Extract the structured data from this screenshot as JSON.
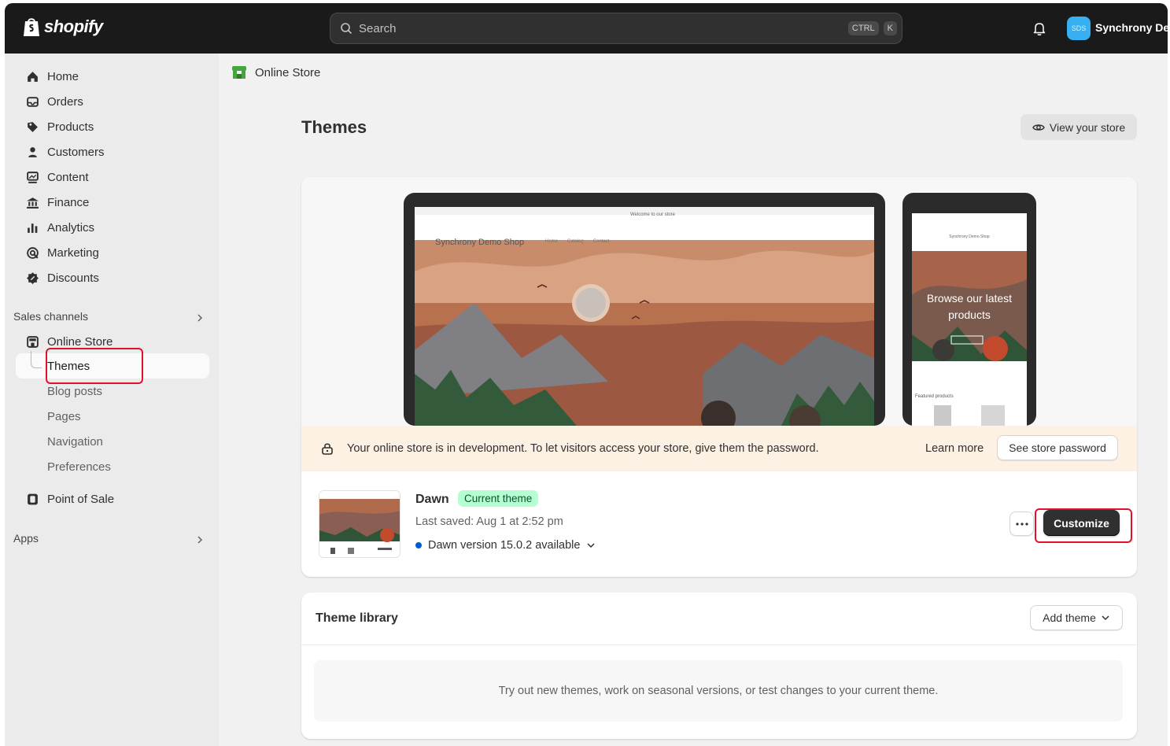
{
  "app": {
    "logo_text": "shopify"
  },
  "topbar": {
    "search_placeholder": "Search",
    "shortcut_ctrl": "CTRL",
    "shortcut_key": "K",
    "avatar_initials": "SDS",
    "store_name": "Synchrony De"
  },
  "sidebar": {
    "items": [
      {
        "label": "Home",
        "icon": "home-icon"
      },
      {
        "label": "Orders",
        "icon": "inbox-icon"
      },
      {
        "label": "Products",
        "icon": "tag-icon"
      },
      {
        "label": "Customers",
        "icon": "person-icon"
      },
      {
        "label": "Content",
        "icon": "image-icon"
      },
      {
        "label": "Finance",
        "icon": "bank-icon"
      },
      {
        "label": "Analytics",
        "icon": "bar-chart-icon"
      },
      {
        "label": "Marketing",
        "icon": "target-icon"
      },
      {
        "label": "Discounts",
        "icon": "discount-icon"
      }
    ],
    "sales_channels_label": "Sales channels",
    "online_store_label": "Online Store",
    "sub_items": [
      "Themes",
      "Blog posts",
      "Pages",
      "Navigation",
      "Preferences"
    ],
    "point_of_sale_label": "Point of Sale",
    "apps_label": "Apps"
  },
  "main": {
    "breadcrumb": "Online Store",
    "title": "Themes",
    "view_store_label": "View your store",
    "preview": {
      "store_title": "Synchrony Demo Shop",
      "announcement": "Welcome to our store",
      "nav_links": [
        "Home",
        "Catalog",
        "Contact"
      ],
      "mobile_store_title": "Synchrony Demo Shop",
      "mobile_hero": "Browse our latest products",
      "mobile_featured": "Featured products"
    },
    "banner": {
      "text": "Your online store is in development. To let visitors access your store, give them the password.",
      "learn_more": "Learn more",
      "password_button": "See store password"
    },
    "current_theme": {
      "name": "Dawn",
      "badge": "Current theme",
      "last_saved": "Last saved: Aug 1 at 2:52 pm",
      "version": "Dawn version 15.0.2 available",
      "customize_label": "Customize"
    },
    "library": {
      "title": "Theme library",
      "add_theme_label": "Add theme",
      "empty_text": "Try out new themes, work on seasonal versions, or test changes to your current theme."
    }
  },
  "colors": {
    "topbar": "#1a1a1a",
    "accent_green": "#b4fed2",
    "highlight_red": "#e3102c",
    "banner_bg": "#fdf1e3"
  }
}
